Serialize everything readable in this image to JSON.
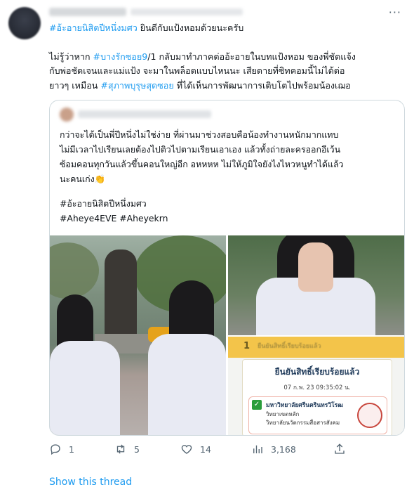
{
  "tweet": {
    "line1_tag": "#อ้ะอายนิสิตปีหนึ่งมศว",
    "line1_rest": " ยินดีกับแป้งหอมด้วยนะครับ",
    "para2_a": "ไม่รู้ว่าหาก ",
    "para2_tag1": "#บางรักซอย9",
    "para2_b": "/1 กลับมาทำภาคต่ออ้ะอายในบทแป้งหอม ของพี่ชัดแจ้ง",
    "para2_line2": "กับพ่อชัดเจนและแม่แป้ง จะมาในพล็อตแบบไหนนะ เสียดายที่ซิทคอมนี้ไม่ได้ต่อ",
    "para2_line3_a": "ยาวๆ เหมือน ",
    "para2_tag2": "#สุภาพบุรุษสุดซอย",
    "para2_line3_b": " ที่ได้เห็นการพัฒนาการเติบโตไปพร้อมน้องเฌอ"
  },
  "quote": {
    "text_l1": "กว่าจะได้เป็นพี่ปีหนึ่งไม่ใช่ง่าย ที่ผ่านมาช่วงสอบคือน้องทำงานหนักมากแทบ",
    "text_l2": "ไม่มีเวลาไปเรียนเลยต้องไปติวไปตามเรียนเอาเอง แล้วทั้งถ่ายละครออกอีเว้น",
    "text_l3": "ซ้อมคอนทุกวันแล้วขึ้นคอนใหญ่อีก อหหหห ไม่ให้ภูมิใจยังไงไหวหนูทำได้แล้ว",
    "text_l4": "นะคนเก่ง👏",
    "tag_line1": "#อ้ะอายนิสิตปีหนึ่งมศว",
    "tag_line2": "#Aheye4EVE #Aheyekrn"
  },
  "media_card": {
    "step_number": "1",
    "header_text": "ยืนยันสิทธิ์เรียบร้อยแล้ว",
    "title": "ยืนยันสิทธิ์เรียบร้อยแล้ว",
    "date": "07 ก.พ. 23 09:35:02 น.",
    "university": "มหาวิทยาลัยศรีนครินทรวิโรฒ",
    "campus": "วิทยาเขตหลัก",
    "college": "วิทยาลัยนวัตกรรมสื่อสารสังคม"
  },
  "actions": {
    "reply_count": "1",
    "retweet_count": "5",
    "like_count": "14",
    "view_count": "3,168"
  },
  "show_thread": "Show this thread",
  "more_glyph": "···",
  "icons": [
    "reply-icon",
    "retweet-icon",
    "like-icon",
    "views-icon",
    "share-icon",
    "more-icon"
  ],
  "colors": {
    "link": "#1d9bf0",
    "muted": "#536471",
    "border": "#cfd9de"
  }
}
